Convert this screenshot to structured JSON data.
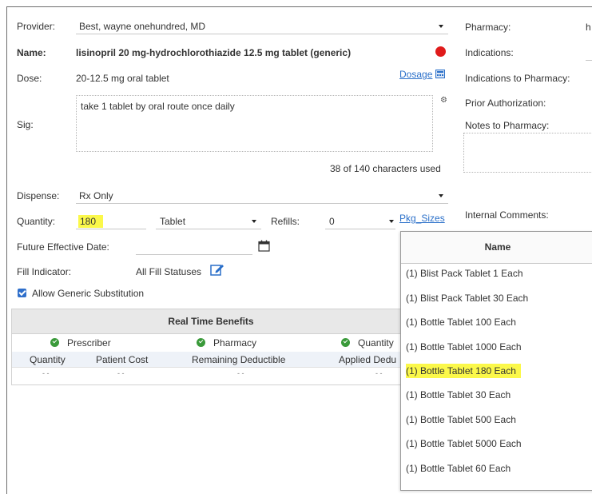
{
  "form": {
    "provider_label": "Provider:",
    "provider_value": "Best, wayne onehundred, MD",
    "name_label": "Name:",
    "name_value": "lisinopril 20 mg-hydrochlorothiazide 12.5 mg tablet (generic)",
    "dose_label": "Dose:",
    "dose_value": "20-12.5 mg oral tablet",
    "dosage_link": "Dosage",
    "sig_label": "Sig:",
    "sig_value": "take 1 tablet by oral route once daily",
    "char_count": "38 of 140 characters used",
    "dispense_label": "Dispense:",
    "dispense_value": "Rx Only",
    "quantity_label": "Quantity:",
    "quantity_value": "180",
    "unit_value": "Tablet",
    "refills_label": "Refills:",
    "refills_value": "0",
    "pkg_sizes_link": "Pkg_Sizes",
    "future_date_label": "Future Effective Date:",
    "fill_indicator_label": "Fill Indicator:",
    "fill_indicator_value": "All Fill Statuses",
    "generic_substitution_label": "Allow Generic Substitution",
    "generic_substitution_checked": true
  },
  "right_panel": {
    "pharmacy_label": "Pharmacy:",
    "pharmacy_value_fragment": "h",
    "indications_label": "Indications:",
    "indications_to_pharmacy_label": "Indications to Pharmacy:",
    "prior_auth_label": "Prior Authorization:",
    "notes_label": "Notes to Pharmacy:",
    "internal_comments_label": "Internal Comments:"
  },
  "rtb": {
    "title": "Real Time Benefits",
    "sources": [
      "Prescriber",
      "Pharmacy",
      "Quantity"
    ],
    "columns": [
      "Quantity",
      "Patient Cost",
      "Remaining Deductible",
      "Applied Dedu"
    ],
    "row": [
      "- -",
      "- -",
      "- -",
      "- -"
    ]
  },
  "pkg_popup": {
    "header": "Name",
    "items": [
      "(1) Blist Pack Tablet 1 Each",
      "(1) Blist Pack Tablet 30 Each",
      "(1) Bottle Tablet 100 Each",
      "(1) Bottle Tablet 1000 Each",
      "(1) Bottle Tablet 180 Each",
      "(1) Bottle Tablet 30 Each",
      "(1) Bottle Tablet 500 Each",
      "(1) Bottle Tablet 5000 Each",
      "(1) Bottle Tablet 60 Each"
    ],
    "highlighted_index": 4
  },
  "colors": {
    "highlight": "#fbf84a",
    "link": "#2a6fc9",
    "status_dot": "#e01b1b",
    "check_green": "#3a9a3a",
    "checkbox_blue": "#2f6fcb"
  }
}
